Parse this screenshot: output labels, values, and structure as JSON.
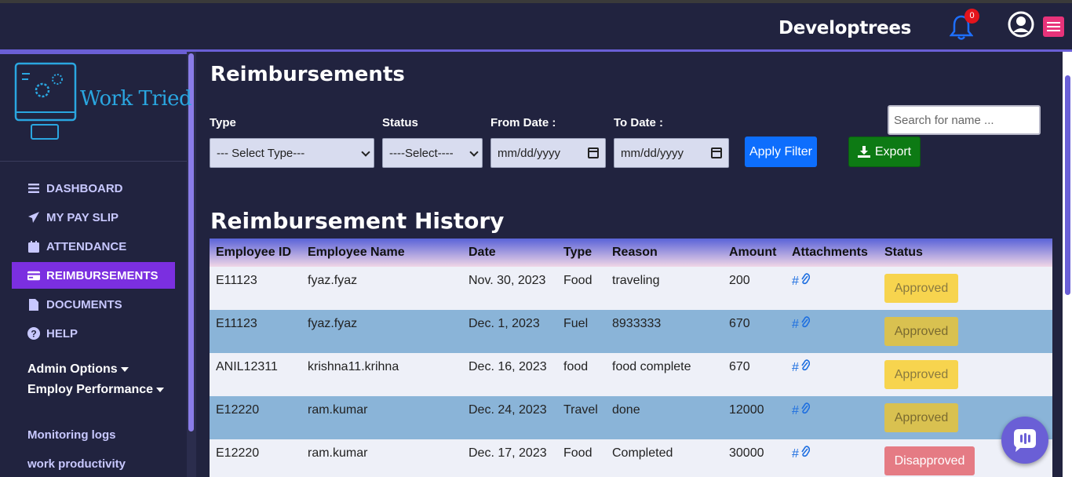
{
  "header": {
    "brand": "Developtrees",
    "notification_count": "0"
  },
  "sidebar": {
    "logo_text": "Work Tried",
    "nav": [
      {
        "label": "DASHBOARD",
        "icon": "list-icon"
      },
      {
        "label": "MY PAY SLIP",
        "icon": "paper-plane-icon"
      },
      {
        "label": "ATTENDANCE",
        "icon": "calendar-icon"
      },
      {
        "label": "REIMBURSEMENTS",
        "icon": "credit-card-icon"
      },
      {
        "label": "DOCUMENTS",
        "icon": "file-icon"
      },
      {
        "label": "HELP",
        "icon": "question-circle-icon"
      }
    ],
    "sections": [
      "Admin Options",
      "Employ Performance"
    ],
    "links": [
      "Monitoring logs",
      "work productivity"
    ]
  },
  "page": {
    "title": "Reimbursements",
    "filters": {
      "type_label": "Type",
      "type_value": "--- Select Type---",
      "status_label": "Status",
      "status_value": "----Select----",
      "from_label": "From Date :",
      "from_value": "mm/dd/yyyy",
      "to_label": "To Date :",
      "to_value": "mm/dd/yyyy",
      "apply_label": "Apply Filter",
      "export_label": "Export",
      "search_placeholder": "Search for name ..."
    },
    "history_title": "Reimbursement History"
  },
  "table": {
    "columns": [
      "Employee ID",
      "Employee Name",
      "Date",
      "Type",
      "Reason",
      "Amount",
      "Attachments",
      "Status"
    ],
    "rows": [
      {
        "id": "E11123",
        "name": "fyaz.fyaz",
        "date": "Nov. 30, 2023",
        "type": "Food",
        "reason": "traveling",
        "amount": "200",
        "attachment": "#",
        "status": "Approved"
      },
      {
        "id": "E11123",
        "name": "fyaz.fyaz",
        "date": "Dec. 1, 2023",
        "type": "Fuel",
        "reason": "8933333",
        "amount": "670",
        "attachment": "#",
        "status": "Approved"
      },
      {
        "id": "ANIL12311",
        "name": "krishna11.krihna",
        "date": "Dec. 16, 2023",
        "type": "food",
        "reason": "food complete",
        "amount": "670",
        "attachment": "#",
        "status": "Approved"
      },
      {
        "id": "E12220",
        "name": "ram.kumar",
        "date": "Dec. 24, 2023",
        "type": "Travel",
        "reason": "done",
        "amount": "12000",
        "attachment": "#",
        "status": "Approved"
      },
      {
        "id": "E12220",
        "name": "ram.kumar",
        "date": "Dec. 17, 2023",
        "type": "Food",
        "reason": "Completed",
        "amount": "30000",
        "attachment": "#",
        "status": "Disapproved"
      }
    ]
  },
  "colors": {
    "accent": "#6a5fd6",
    "active_nav": "#7b2fe0",
    "apply": "#0d6efd",
    "export": "#0d7a14",
    "approved": "#f7d44e",
    "disapproved": "#e57b84"
  }
}
